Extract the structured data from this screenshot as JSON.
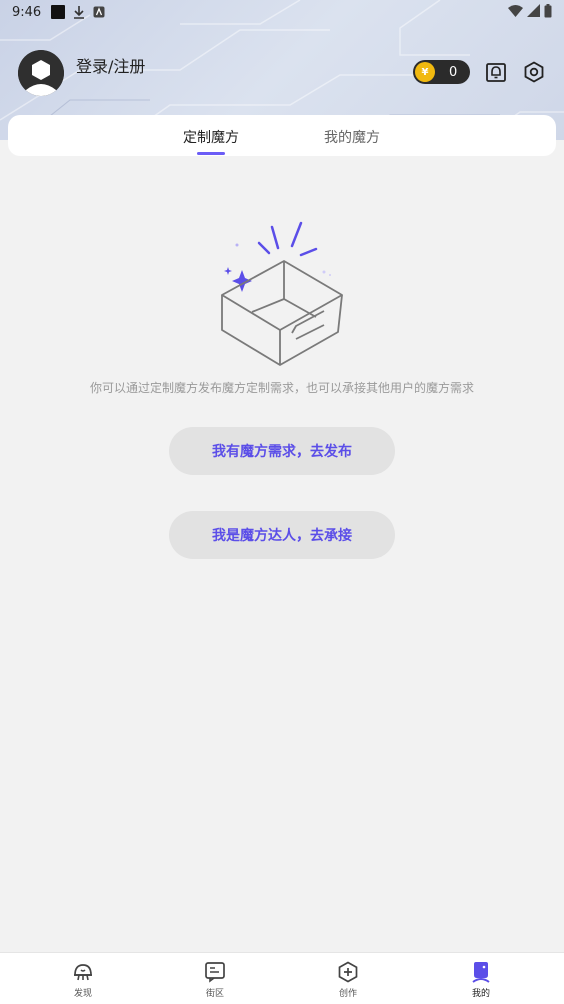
{
  "status_bar": {
    "time": "9:46"
  },
  "header": {
    "login_label": "登录/注册",
    "coin_count": "0",
    "coin_symbol": "¥"
  },
  "tabs": [
    {
      "label": "定制魔方",
      "active": true
    },
    {
      "label": "我的魔方",
      "active": false
    }
  ],
  "empty_state": {
    "description": "你可以通过定制魔方发布魔方定制需求，也可以承接其他用户的魔方需求"
  },
  "actions": {
    "publish_label": "我有魔方需求，去发布",
    "accept_label": "我是魔方达人，去承接"
  },
  "bottom_nav": [
    {
      "label": "发现",
      "icon": "discover-icon"
    },
    {
      "label": "街区",
      "icon": "street-icon"
    },
    {
      "label": "创作",
      "icon": "create-icon"
    },
    {
      "label": "我的",
      "icon": "profile-icon",
      "active": true
    }
  ],
  "colors": {
    "accent": "#6b5cf6",
    "button_text": "#5b4ee8",
    "coin": "#f1b90f"
  }
}
